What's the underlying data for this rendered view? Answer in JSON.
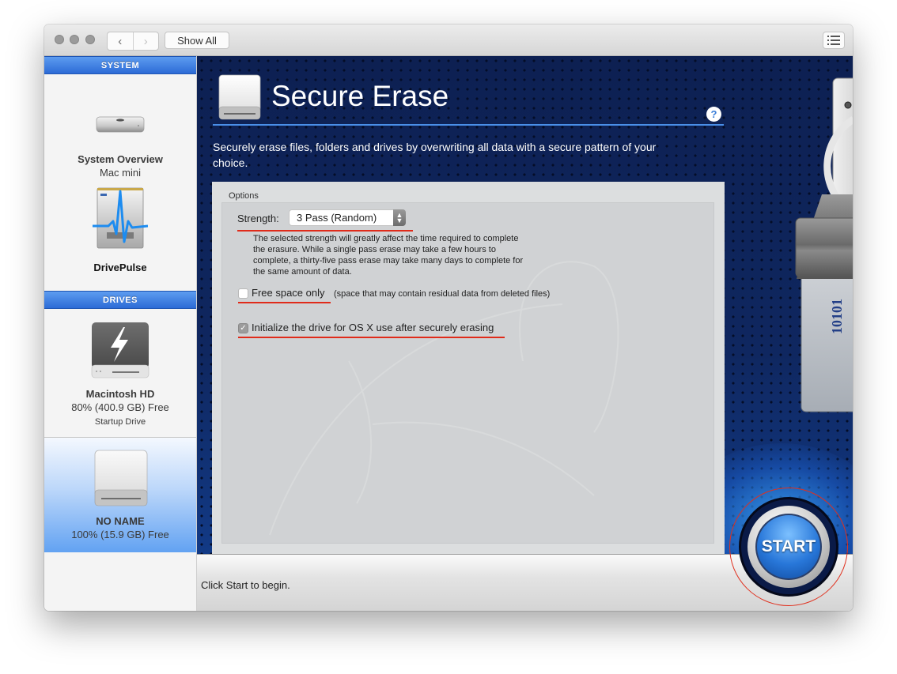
{
  "toolbar": {
    "back_icon": "chevron-left-icon",
    "forward_icon": "chevron-right-icon",
    "show_all_label": "Show All",
    "list_icon": "list-view-icon"
  },
  "sidebar": {
    "system_header": "SYSTEM",
    "drives_header": "DRIVES",
    "system_items": [
      {
        "name": "System Overview",
        "sub": "Mac mini",
        "icon": "mac-mini-icon"
      },
      {
        "name": "DrivePulse",
        "icon": "drivepulse-icon"
      }
    ],
    "drive_items": [
      {
        "name": "Macintosh HD",
        "sub": "80% (400.9 GB) Free",
        "sub2": "Startup Drive",
        "icon": "thunderbolt-drive-icon",
        "selected": false
      },
      {
        "name": "NO NAME",
        "sub": "100% (15.9 GB) Free",
        "icon": "external-drive-icon",
        "selected": true
      }
    ]
  },
  "main": {
    "title": "Secure Erase",
    "help_label": "?",
    "description": "Securely erase files, folders and drives by overwriting all data with a secure pattern of your choice.",
    "options": {
      "group_label": "Options",
      "strength_label": "Strength:",
      "strength_value": "3 Pass (Random)",
      "strength_help": "The selected strength will greatly affect the time required to complete the erasure. While a single pass erase may take a few hours to complete, a thirty-five pass erase may take many days to complete for the same amount of data.",
      "free_space_label": "Free space only",
      "free_space_checked": false,
      "free_space_note": "(space that may contain residual data from deleted files)",
      "initialize_label": "Initialize the drive for OS X use after securely erasing",
      "initialize_checked": true
    },
    "shredder_text": "10101"
  },
  "status": {
    "text": "Click Start to begin.",
    "start_label": "START"
  },
  "colors": {
    "accent_blue": "#2c6bd6",
    "annotation_red": "#e02b1a",
    "background_navy": "#0c1e4d"
  }
}
